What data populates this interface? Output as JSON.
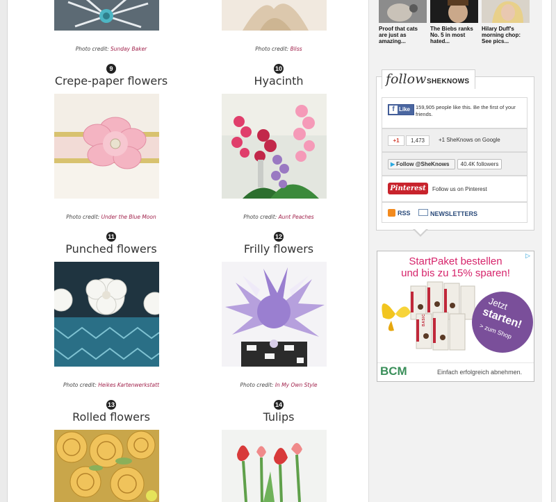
{
  "gallery": {
    "top_credits": [
      {
        "prefix": "Photo credit: ",
        "source": "Sunday Baker"
      },
      {
        "prefix": "Photo credit: ",
        "source": "Bliss"
      }
    ],
    "items": [
      {
        "number": "9",
        "title": "Crepe-paper flowers",
        "credit_prefix": "Photo credit: ",
        "credit_source": "Under the Blue Moon"
      },
      {
        "number": "10",
        "title": "Hyacinth",
        "credit_prefix": "Photo credit: ",
        "credit_source": "Aunt Peaches"
      },
      {
        "number": "11",
        "title": "Punched flowers",
        "credit_prefix": "Photo credit: ",
        "credit_source": "Heikes Kartenwerkstatt"
      },
      {
        "number": "12",
        "title": "Frilly flowers",
        "credit_prefix": "Photo credit: ",
        "credit_source": "In My Own Style"
      },
      {
        "number": "13",
        "title": "Rolled flowers"
      },
      {
        "number": "14",
        "title": "Tulips"
      }
    ]
  },
  "sidebar": {
    "stories": [
      {
        "caption": "Proof that cats are just as amazing..."
      },
      {
        "caption": "The Biebs ranks No. 5 in most hated..."
      },
      {
        "caption": "Hilary Duff's morning chop: See pics..."
      }
    ],
    "follow": {
      "title_script": "follow",
      "brand": "SHEKNOWS",
      "facebook": {
        "button": "Like",
        "text": "159,905 people like this. Be the first of your friends."
      },
      "googleplus": {
        "button": "+1",
        "count": "1,473",
        "text": "+1 SheKnows on Google"
      },
      "twitter": {
        "button": "Follow @SheKnows",
        "count": "40.4K followers"
      },
      "pinterest": {
        "logo": "Pinterest",
        "text": "Follow us on Pinterest"
      },
      "rss_label": "RSS",
      "newsletters_label": "NEWSLETTERS"
    },
    "ad": {
      "headline_1": "StartPaket bestellen",
      "headline_2": "und bis zu 15% sparen!",
      "badge_1": "Jetzt",
      "badge_2": "starten!",
      "badge_3": "> zum Shop",
      "brand": "BCM",
      "tagline": "Einfach erfolgreich abnehmen.",
      "product_label": "BASIC"
    }
  }
}
